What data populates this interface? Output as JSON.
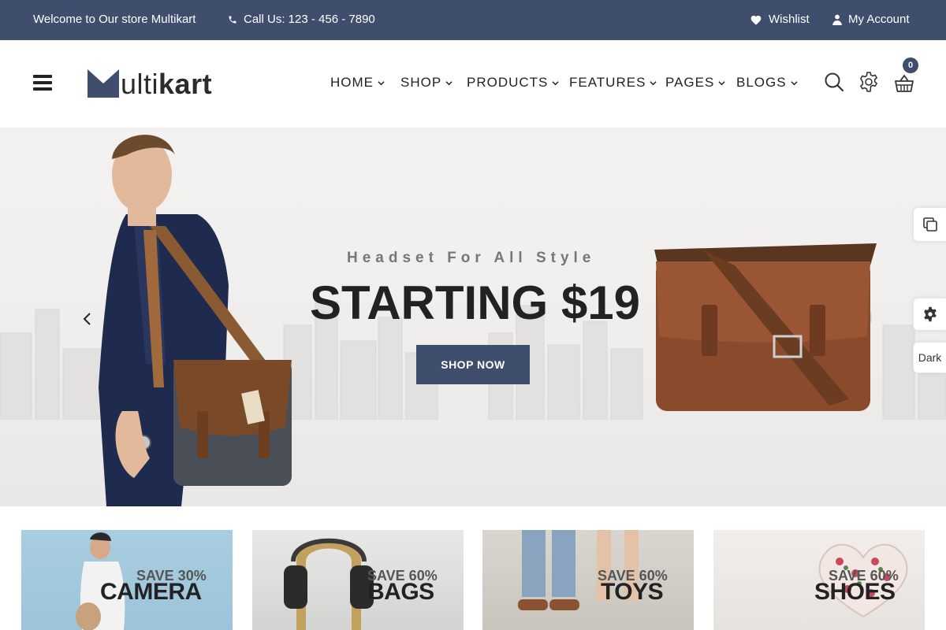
{
  "topbar": {
    "welcome": "Welcome to Our store Multikart",
    "phone": "Call Us: 123 - 456 - 7890",
    "wishlist": "Wishlist",
    "account": "My Account"
  },
  "header": {
    "logo_light": "ulti",
    "logo_bold": "kart",
    "nav": [
      "HOME",
      "SHOP",
      "PRODUCTS",
      "FEATURES",
      "PAGES",
      "BLOGS"
    ],
    "cart_count": "0"
  },
  "hero": {
    "subtitle": "Headset For All Style",
    "title": "STARTING $19",
    "button": "SHOP NOW"
  },
  "side": {
    "dark_label": "Dark"
  },
  "banners": [
    {
      "save": "SAVE 30%",
      "category": "CAMERA"
    },
    {
      "save": "SAVE 60%",
      "category": "BAGS"
    },
    {
      "save": "SAVE 60%",
      "category": "TOYS"
    },
    {
      "save": "SAVE 60%",
      "category": "SHOES"
    }
  ],
  "colors": {
    "brand": "#3e4e6c",
    "text": "#222222"
  },
  "icons": {
    "phone": "phone-icon",
    "heart": "heart-icon",
    "user": "user-icon",
    "search": "search-icon",
    "settings": "gear-icon",
    "cart": "basket-icon"
  }
}
